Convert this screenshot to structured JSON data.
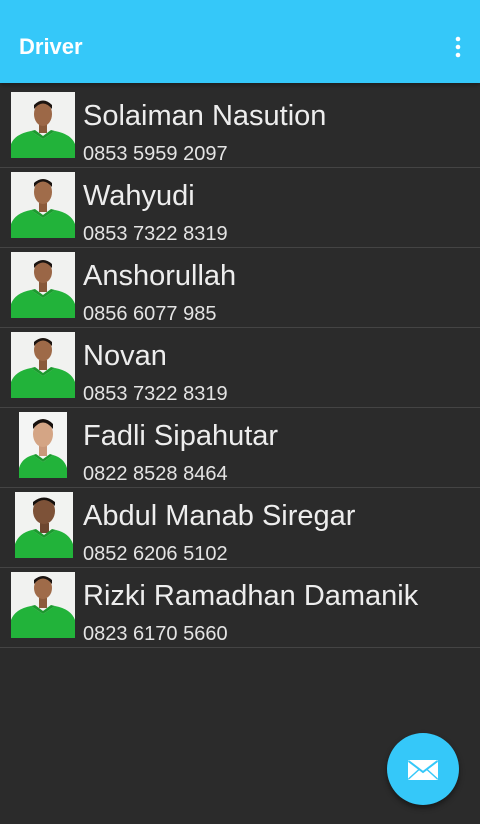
{
  "appbar": {
    "title": "Driver",
    "menu_icon": "more-vert-icon",
    "color": "#35c8f9"
  },
  "drivers": [
    {
      "name": "Solaiman Nasution",
      "phone": "0853 5959 2097"
    },
    {
      "name": "Wahyudi",
      "phone": "0853 7322 8319"
    },
    {
      "name": "Anshorullah",
      "phone": "0856 6077 985"
    },
    {
      "name": "Novan",
      "phone": "0853 7322 8319"
    },
    {
      "name": "Fadli Sipahutar",
      "phone": "0822 8528 8464"
    },
    {
      "name": "Abdul Manab Siregar",
      "phone": "0852 6206 5102"
    },
    {
      "name": "Rizki Ramadhan Damanik",
      "phone": "0823 6170 5660"
    }
  ],
  "fab": {
    "icon": "mail-icon"
  },
  "colors": {
    "background": "#2b2b2b",
    "accent": "#35c8f9",
    "uniform": "#22b33a"
  }
}
